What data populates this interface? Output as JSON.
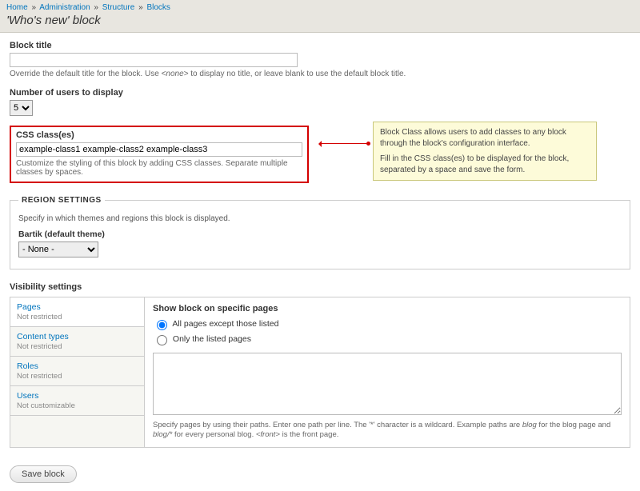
{
  "breadcrumb": {
    "home": "Home",
    "admin": "Administration",
    "structure": "Structure",
    "blocks": "Blocks",
    "sep": "»"
  },
  "page_title": "'Who's new' block",
  "block_title": {
    "label": "Block title",
    "value": "",
    "desc_a": "Override the default title for the block. Use ",
    "desc_code": "<none>",
    "desc_b": " to display no title, or leave blank to use the default block title."
  },
  "num_users": {
    "label": "Number of users to display",
    "value": "5"
  },
  "css": {
    "label": "CSS class(es)",
    "value": "example-class1 example-class2 example-class3",
    "desc": "Customize the styling of this block by adding CSS classes. Separate multiple classes by spaces."
  },
  "callout": {
    "p1": "Block Class allows users to add classes to any block through the block's configuration interface.",
    "p2": "Fill in the CSS class(es) to be displayed for the block, separated by a space and save the form."
  },
  "region": {
    "legend": "REGION SETTINGS",
    "desc": "Specify in which themes and regions this block is displayed.",
    "theme": "Bartik (default theme)",
    "value": "- None -"
  },
  "visibility": {
    "title": "Visibility settings",
    "tabs": [
      {
        "name": "Pages",
        "sub": "Not restricted"
      },
      {
        "name": "Content types",
        "sub": "Not restricted"
      },
      {
        "name": "Roles",
        "sub": "Not restricted"
      },
      {
        "name": "Users",
        "sub": "Not customizable"
      }
    ],
    "pane": {
      "title": "Show block on specific pages",
      "opt1": "All pages except those listed",
      "opt2": "Only the listed pages",
      "desc_a": "Specify pages by using their paths. Enter one path per line. The '*' character is a wildcard. Example paths are ",
      "desc_em1": "blog",
      "desc_b": " for the blog page and ",
      "desc_em2": "blog/*",
      "desc_c": " for every personal blog. ",
      "desc_em3": "<front>",
      "desc_d": " is the front page."
    }
  },
  "save_label": "Save block"
}
